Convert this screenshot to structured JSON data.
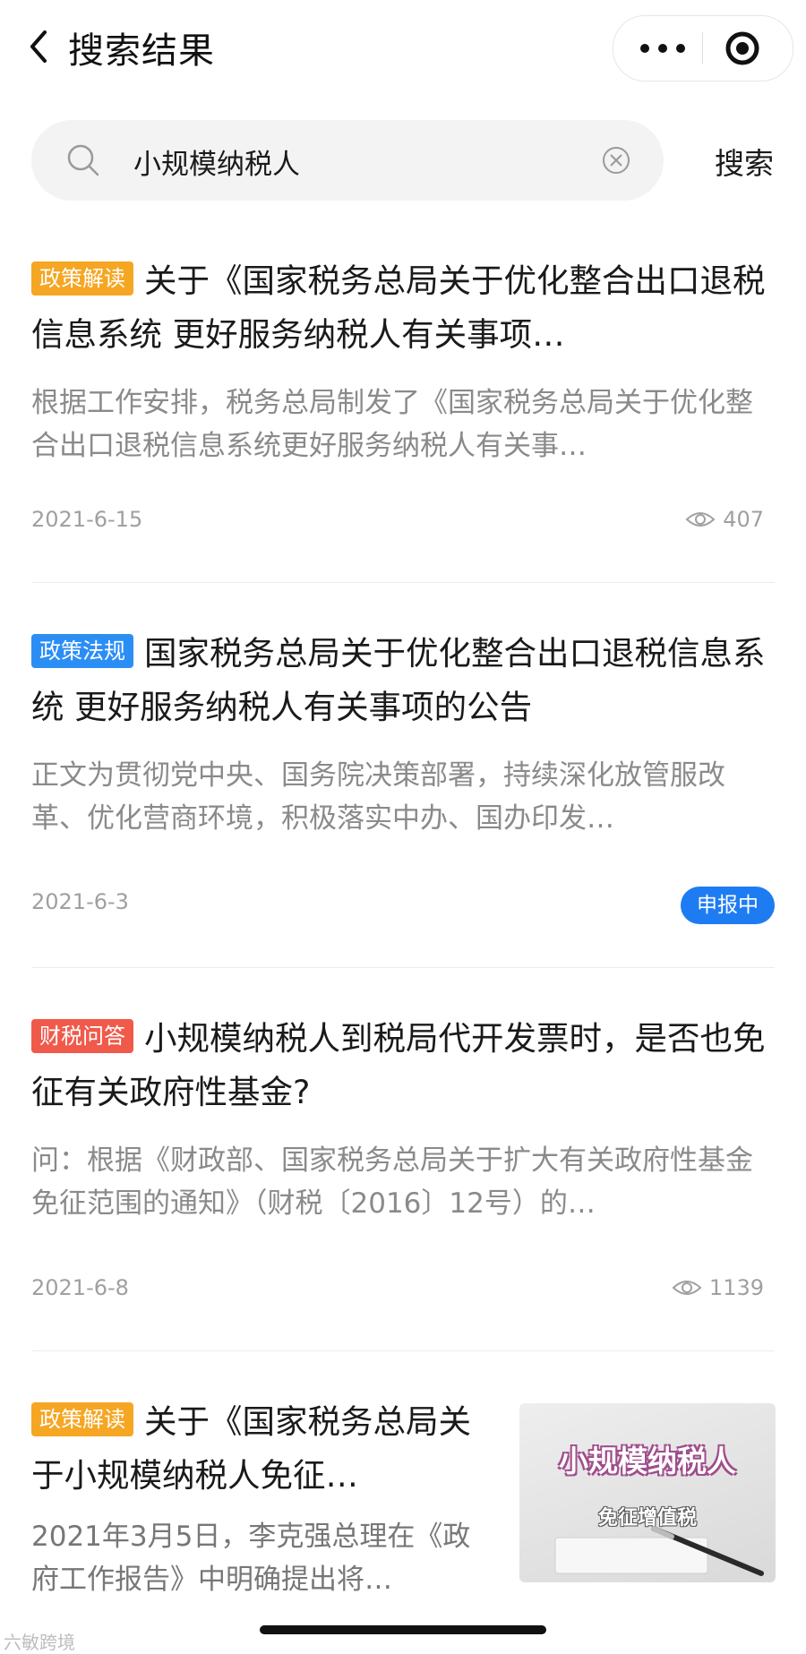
{
  "header": {
    "title": "搜索结果"
  },
  "search": {
    "query": "小规模纳税人",
    "button_label": "搜索"
  },
  "results": [
    {
      "tag": "政策解读",
      "tag_color": "#f5a623",
      "title": "关于《国家税务总局关于优化整合出口退税信息系统 更好服务纳税人有关事项…",
      "summary": "根据工作安排，税务总局制发了《国家税务总局关于优化整合出口退税信息系统更好服务纳税人有关事…",
      "date": "2021-6-15",
      "views": "407"
    },
    {
      "tag": "政策法规",
      "tag_color": "#2b8ef5",
      "title": "国家税务总局关于优化整合出口退税信息系统 更好服务纳税人有关事项的公告",
      "summary": "正文为贯彻党中央、国务院决策部署，持续深化放管服改革、优化营商环境，积极落实中办、国办印发…",
      "date": "2021-6-3",
      "status": "申报中"
    },
    {
      "tag": "财税问答",
      "tag_color": "#f05a4a",
      "title": "小规模纳税人到税局代开发票时，是否也免征有关政府性基金?",
      "summary": "问：根据《财政部、国家税务总局关于扩大有关政府性基金免征范围的通知》（财税〔2016〕12号）的…",
      "date": "2021-6-8",
      "views": "1139"
    },
    {
      "tag": "政策解读",
      "tag_color": "#f5a623",
      "title": "关于《国家税务总局关于小规模纳税人免征…",
      "summary": "2021年3月5日，李克强总理在《政府工作报告》中明确提出将…",
      "thumb_title": "小规模纳税人",
      "thumb_subtitle": "免征增值税"
    }
  ],
  "watermark": "六敏跨境",
  "icons": {
    "back": "chevron-left-icon",
    "more": "more-dots-icon",
    "close": "target-close-icon",
    "search": "search-icon",
    "clear": "clear-circle-x-icon",
    "views": "eye-icon"
  }
}
